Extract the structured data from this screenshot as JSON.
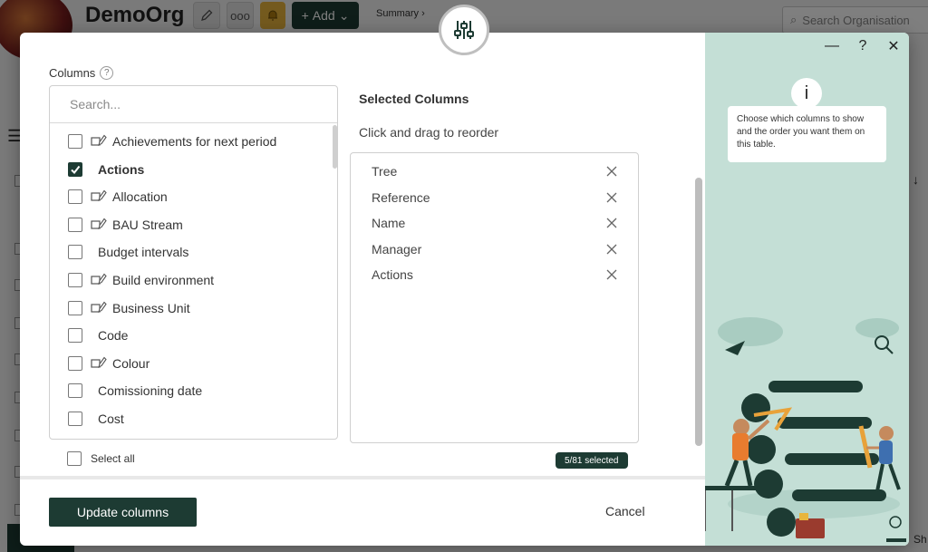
{
  "background": {
    "org_name": "DemoOrg",
    "add_label": "Add",
    "summary_label": "Summary ›",
    "search_placeholder": "Search Organisation",
    "corner_text": "Sh"
  },
  "modal": {
    "columns_label": "Columns",
    "search_placeholder": "Search...",
    "available_columns": [
      {
        "label": "Achievements for next period",
        "checked": false,
        "has_icon": true
      },
      {
        "label": "Actions",
        "checked": true,
        "has_icon": false
      },
      {
        "label": "Allocation",
        "checked": false,
        "has_icon": true
      },
      {
        "label": "BAU Stream",
        "checked": false,
        "has_icon": true
      },
      {
        "label": "Budget intervals",
        "checked": false,
        "has_icon": false
      },
      {
        "label": "Build environment",
        "checked": false,
        "has_icon": true
      },
      {
        "label": "Business Unit",
        "checked": false,
        "has_icon": true
      },
      {
        "label": "Code",
        "checked": false,
        "has_icon": false
      },
      {
        "label": "Colour",
        "checked": false,
        "has_icon": true
      },
      {
        "label": "Comissioning date",
        "checked": false,
        "has_icon": false
      },
      {
        "label": "Cost",
        "checked": false,
        "has_icon": false
      }
    ],
    "select_all_label": "Select all",
    "selected_title": "Selected Columns",
    "selected_subtitle": "Click and drag to reorder",
    "selected_columns": [
      "Tree",
      "Reference",
      "Name",
      "Manager",
      "Actions"
    ],
    "selected_count_label": "5/81 selected",
    "update_button": "Update columns",
    "cancel_button": "Cancel"
  },
  "info_panel": {
    "minimize_glyph": "—",
    "help_glyph": "?",
    "close_glyph": "✕",
    "info_glyph": "i",
    "info_text": "Choose which columns to show and the order you want them on this table."
  },
  "colors": {
    "accent": "#1d3b33",
    "panel_bg": "#c4dfd6"
  }
}
